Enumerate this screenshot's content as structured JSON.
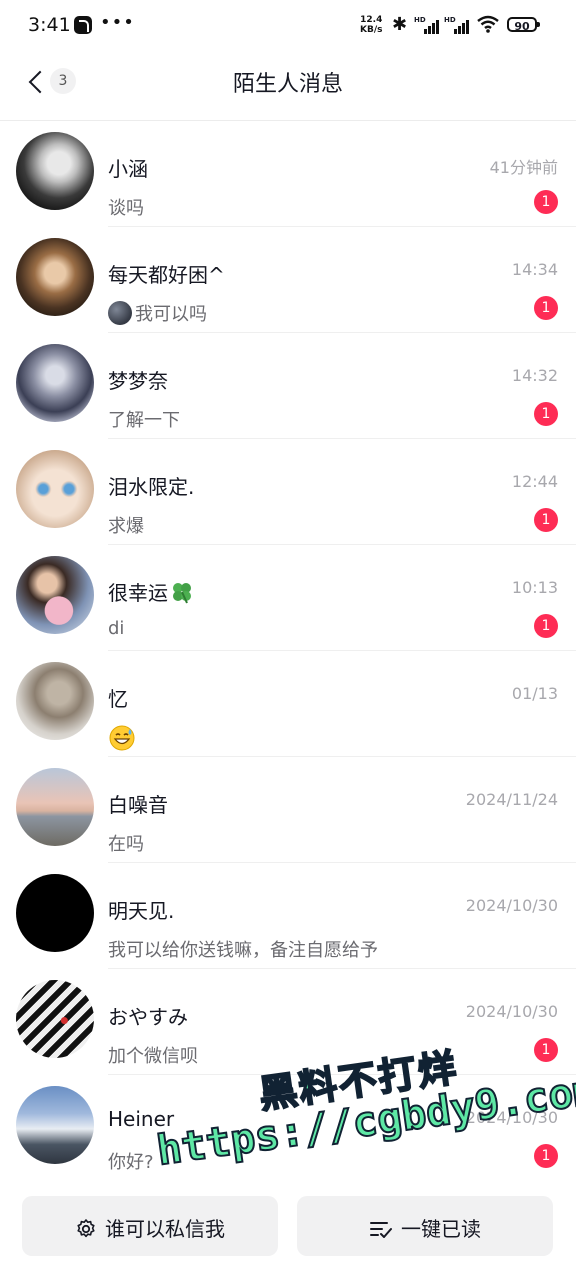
{
  "status_bar": {
    "time": "3:41",
    "dots": "•••",
    "net_speed_value": "12.4",
    "net_speed_unit": "KB/s",
    "hd1": "HD",
    "hd2": "HD",
    "battery": "90"
  },
  "nav": {
    "back_count": "3",
    "title": "陌生人消息"
  },
  "messages": [
    {
      "name": "小涵",
      "preview": "谈吗",
      "time": "41分钟前",
      "badge": "1"
    },
    {
      "name": "每天都好困^",
      "preview": "我可以吗",
      "time": "14:34",
      "badge": "1"
    },
    {
      "name": "梦梦奈",
      "preview": "了解一下",
      "time": "14:32",
      "badge": "1"
    },
    {
      "name": "泪水限定.",
      "preview": "求爆",
      "time": "12:44",
      "badge": "1"
    },
    {
      "name": "很幸运",
      "preview": "di",
      "time": "10:13",
      "badge": "1"
    },
    {
      "name": "忆",
      "preview": "",
      "time": "01/13",
      "badge": ""
    },
    {
      "name": "白噪音",
      "preview": "在吗",
      "time": "2024/11/24",
      "badge": ""
    },
    {
      "name": "明天见.",
      "preview": "我可以给你送钱嘛，备注自愿给予",
      "time": "2024/10/30",
      "badge": ""
    },
    {
      "name": "おやすみ",
      "preview": "加个微信呗",
      "time": "2024/10/30",
      "badge": "1"
    },
    {
      "name": "Heiner",
      "preview": "你好?",
      "time": "2024/10/30",
      "badge": "1"
    }
  ],
  "bottom": {
    "privacy_button": "谁可以私信我",
    "mark_read_button": "一键已读"
  },
  "watermark": {
    "line1": "黑料不打烊",
    "line2": "https://cgbdy9.com"
  },
  "colors": {
    "badge": "#fe2c55",
    "watermark": "#5ee8a5"
  }
}
